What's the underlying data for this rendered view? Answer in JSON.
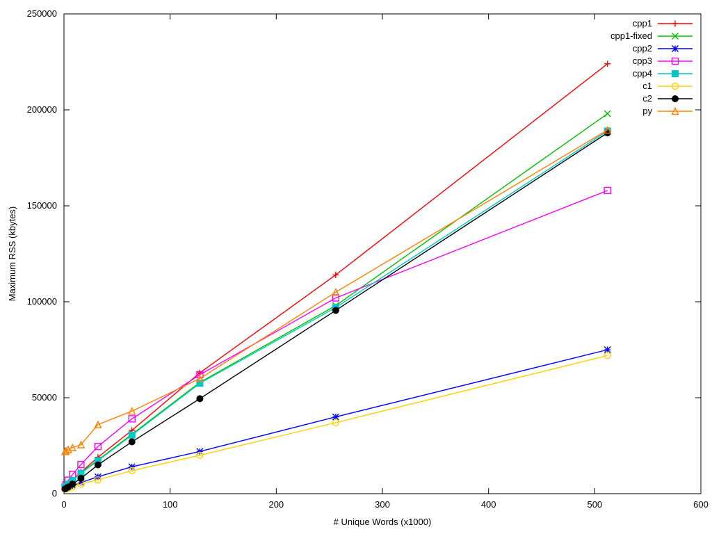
{
  "chart_data": {
    "type": "line",
    "xlabel": "# Unique Words (x1000)",
    "ylabel": "Maximum RSS (kbytes)",
    "title": "",
    "xlim": [
      0,
      600
    ],
    "ylim": [
      0,
      250000
    ],
    "xticks": [
      0,
      100,
      200,
      300,
      400,
      500,
      600
    ],
    "yticks": [
      0,
      50000,
      100000,
      150000,
      200000,
      250000
    ],
    "x": [
      1,
      2,
      4,
      8,
      16,
      32,
      64,
      128,
      256,
      512
    ],
    "series": [
      {
        "name": "cpp1",
        "color": "#ff0000",
        "marker": "plus",
        "values": [
          3600,
          4000,
          5200,
          7200,
          11200,
          19000,
          33000,
          63000,
          114000,
          224000
        ]
      },
      {
        "name": "cpp1-fixed",
        "color": "#00c000",
        "marker": "x",
        "values": [
          3500,
          3800,
          5000,
          7000,
          11000,
          17500,
          31000,
          58000,
          98000,
          198000
        ]
      },
      {
        "name": "cpp2",
        "color": "#0000ff",
        "marker": "star",
        "values": [
          3100,
          3200,
          3600,
          4200,
          5800,
          8800,
          14000,
          22000,
          40000,
          75000
        ]
      },
      {
        "name": "cpp3",
        "color": "#ff00ff",
        "marker": "square-open",
        "values": [
          3400,
          4600,
          7000,
          10000,
          15200,
          24600,
          39000,
          62000,
          102000,
          158000
        ]
      },
      {
        "name": "cpp4",
        "color": "#00c8c8",
        "marker": "square",
        "values": [
          3500,
          3800,
          4900,
          6900,
          10600,
          17200,
          30500,
          57500,
          97000,
          189000
        ]
      },
      {
        "name": "c1",
        "color": "#ffd000",
        "marker": "circle-open",
        "values": [
          2400,
          2500,
          2800,
          3500,
          5000,
          7200,
          12000,
          20000,
          37000,
          72000
        ]
      },
      {
        "name": "c2",
        "color": "#000000",
        "marker": "circle",
        "values": [
          2500,
          2800,
          3500,
          5000,
          8000,
          15000,
          27000,
          49500,
          95500,
          188000
        ]
      },
      {
        "name": "py",
        "color": "#ff8000",
        "marker": "triangle-open",
        "values": [
          22000,
          22300,
          23000,
          24000,
          25500,
          36000,
          43000,
          60000,
          105000,
          189500
        ]
      }
    ],
    "legend_position": "top-right"
  }
}
